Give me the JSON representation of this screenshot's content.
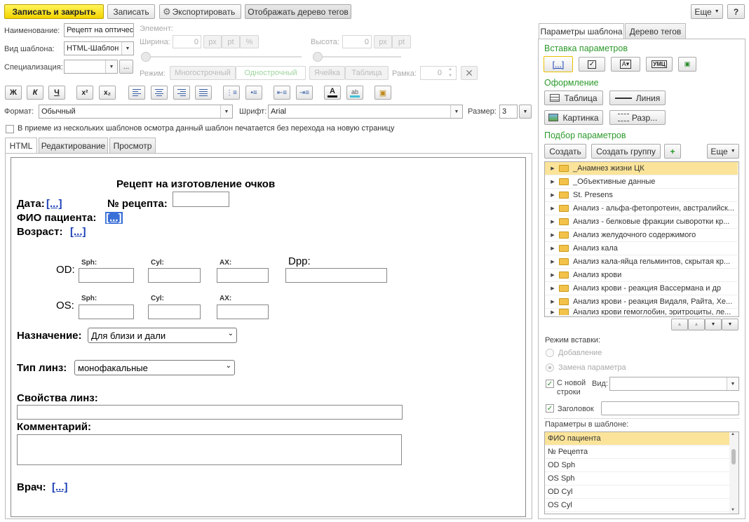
{
  "toolbar": {
    "save_close": "Записать и закрыть",
    "save": "Записать",
    "export": "Экспортировать",
    "show_tree": "Отображать дерево тегов",
    "more": "Еще",
    "help": "?"
  },
  "props": {
    "name_label": "Наименование:",
    "name_value": "Рецепт на оптичес",
    "type_label": "Вид шаблона:",
    "type_value": "HTML-Шаблон",
    "spec_label": "Специализация:",
    "spec_value": "",
    "spec_btn": "...",
    "element_label": "Элемент:",
    "width_label": "Ширина:",
    "width_value": "0",
    "height_label": "Высота:",
    "height_value": "0",
    "unit_px": "px",
    "unit_pt": "pt",
    "unit_pct": "%",
    "mode_label": "Режим:",
    "mode_multi": "Многострочный",
    "mode_single": "Однострочный",
    "cell": "Ячейка",
    "table": "Таблица",
    "frame_label": "Рамка:",
    "frame_value": "0"
  },
  "format": {
    "bold": "Ж",
    "italic": "К",
    "underline": "Ч",
    "sup": "x²",
    "sub": "x₂",
    "format_label": "Формат:",
    "format_value": "Обычный",
    "font_label": "Шрифт:",
    "font_value": "Arial",
    "size_label": "Размер:",
    "size_value": "3",
    "checkbox_text": "В приеме из нескольких шаблонов осмотра данный шаблон печатается без перехода на новую страницу"
  },
  "tabs": [
    "HTML",
    "Редактирование",
    "Просмотр"
  ],
  "doc": {
    "title": "Рецепт на изготовление очков",
    "date_label": "Дата:",
    "placeholder": "[...]",
    "recipe_no": "№ рецепта:",
    "patient": "ФИО пациента:",
    "age": "Возраст:",
    "sph": "Sph:",
    "cyl": "Cyl:",
    "ax": "AX:",
    "dpp": "Dpp:",
    "od": "OD:",
    "os": "OS:",
    "purpose_label": "Назначение:",
    "purpose_value": "Для близи и дали",
    "lens_label": "Тип линз:",
    "lens_value": "монофакальные",
    "props_label": "Свойства линз:",
    "comment_label": "Комментарий:",
    "doctor_label": "Врач:"
  },
  "right": {
    "tab_params": "Параметры шаблона",
    "tab_tree": "Дерево тегов",
    "insert_params": "Вставка параметров",
    "design": "Оформление",
    "table_btn": "Таблица",
    "line_btn": "Линия",
    "picture_btn": "Картинка",
    "break_btn": "Разр...",
    "pick_params": "Подбор параметров",
    "create": "Создать",
    "create_group": "Создать группу",
    "more": "Еще",
    "tree_items": [
      "_Анамнез жизни ЦК",
      "_Объективные данные",
      "St. Presens",
      "Анализ - альфа-фетопротеин, австралийск...",
      "Анализ - белковые фракции сыворотки кр...",
      "Анализ желудочного содержимого",
      "Анализ кала",
      "Анализ кала-яйца гельминтов, скрытая кр...",
      "Анализ крови",
      "Анализ крови - реакция Вассермана и др",
      "Анализ крови - реакция Видаля, Райта, Хе...",
      "Анализ крови гемоглобин, эритроциты, ле..."
    ],
    "insert_mode": "Режим вставки:",
    "mode_add": "Добавление",
    "mode_replace": "Замена параметра",
    "new_line": "С новой строки",
    "view_label": "Вид:",
    "header_label": "Заголовок",
    "params_in_template": "Параметры в шаблоне:",
    "params": [
      "ФИО пациента",
      "№ Рецепта",
      "OD Sph",
      "OS Sph",
      "OD Cyl",
      "OS Cyl"
    ]
  },
  "colors": {
    "accent_yellow": "#f4d400",
    "section_green": "#2c9a2c",
    "selected_row": "#fbe49a",
    "link_blue": "#1a3fb5"
  }
}
